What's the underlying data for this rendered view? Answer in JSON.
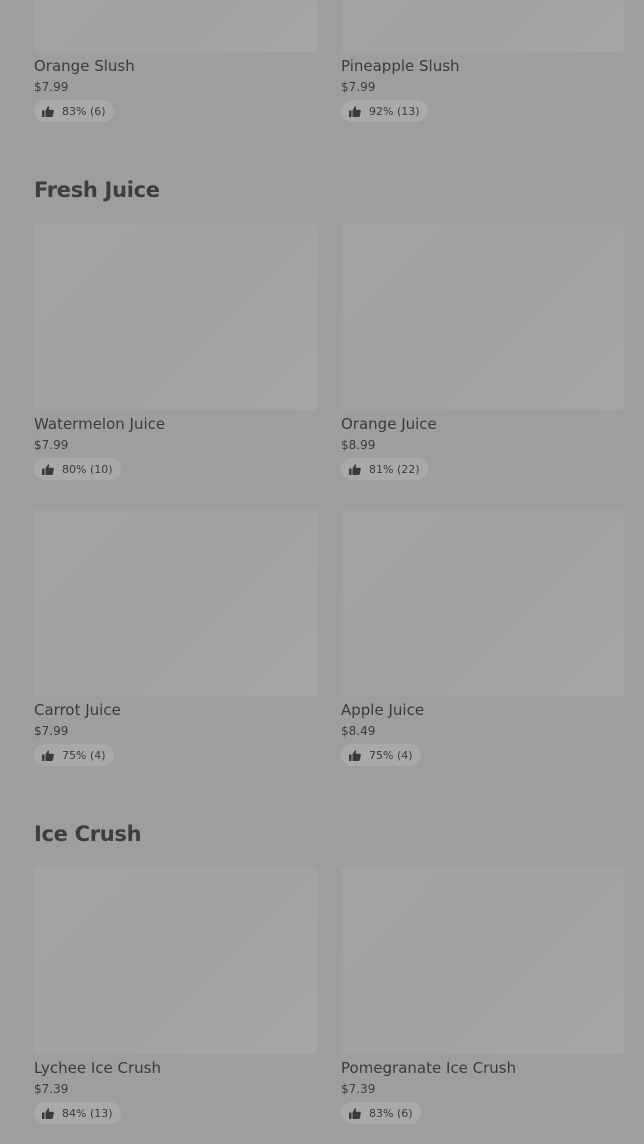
{
  "sections": [
    {
      "title": "",
      "items": [
        {
          "name": "Orange Slush",
          "price": "$7.99",
          "rating": "83% (6)"
        },
        {
          "name": "Pineapple Slush",
          "price": "$7.99",
          "rating": "92% (13)"
        }
      ]
    },
    {
      "title": "Fresh Juice",
      "items": [
        {
          "name": "Watermelon Juice",
          "price": "$7.99",
          "rating": "80% (10)"
        },
        {
          "name": "Orange Juice",
          "price": "$8.99",
          "rating": "81% (22)"
        },
        {
          "name": "Carrot Juice",
          "price": "$7.99",
          "rating": "75% (4)"
        },
        {
          "name": "Apple Juice",
          "price": "$8.49",
          "rating": "75% (4)"
        }
      ]
    },
    {
      "title": "Ice Crush",
      "items": [
        {
          "name": "Lychee Ice Crush",
          "price": "$7.39",
          "rating": "84% (13)"
        },
        {
          "name": "Pomegranate Ice Crush",
          "price": "$7.39",
          "rating": "83% (6)"
        }
      ]
    }
  ],
  "icons": {
    "rating": "thumbs-up-icon"
  }
}
